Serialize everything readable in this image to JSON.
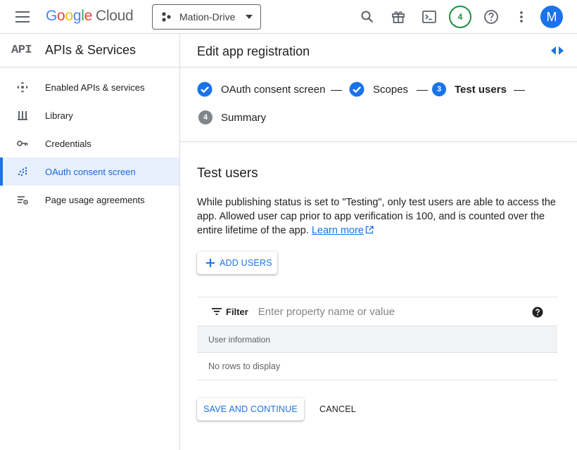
{
  "topbar": {
    "menu_icon": "hamburger-menu-icon",
    "logo": {
      "letters": [
        "G",
        "o",
        "o",
        "g",
        "l",
        "e"
      ],
      "product": "Cloud"
    },
    "project": {
      "name": "Mation-Drive",
      "icon": "project-icon",
      "dropdown_icon": "caret-down-icon"
    },
    "icons": [
      "search-icon",
      "gift-icon",
      "cloud-shell-icon",
      "notifications-badge",
      "help-icon",
      "more-vert-icon"
    ],
    "notification_count": "4",
    "avatar_initial": "M"
  },
  "sidebar": {
    "logo": "API",
    "title": "APIs & Services",
    "items": [
      {
        "label": "Enabled APIs & services",
        "icon": "move-icon",
        "active": false
      },
      {
        "label": "Library",
        "icon": "library-icon",
        "active": false
      },
      {
        "label": "Credentials",
        "icon": "key-icon",
        "active": false
      },
      {
        "label": "OAuth consent screen",
        "icon": "dotted-grid-icon",
        "active": true
      },
      {
        "label": "Page usage agreements",
        "icon": "settings-list-icon",
        "active": false
      }
    ]
  },
  "main": {
    "title": "Edit app registration",
    "steps": [
      {
        "label": "OAuth consent screen",
        "status": "done"
      },
      {
        "label": "Scopes",
        "status": "done"
      },
      {
        "label": "Test users",
        "number": "3",
        "status": "current"
      },
      {
        "label": "Summary",
        "number": "4",
        "status": "upcoming"
      }
    ],
    "section_title": "Test users",
    "description": "While publishing status is set to \"Testing\", only test users are able to access the app. Allowed user cap prior to app verification is 100, and is counted over the entire lifetime of the app.",
    "learn_more": "Learn more",
    "add_users_label": "ADD USERS",
    "filter": {
      "label": "Filter",
      "placeholder": "Enter property name or value"
    },
    "table": {
      "column": "User information",
      "empty_text": "No rows to display"
    },
    "save_label": "SAVE AND CONTINUE",
    "cancel_label": "CANCEL"
  },
  "colors": {
    "accent": "#1a73e8",
    "active_bg": "#e8f0fe",
    "success": "#1e8e3e",
    "muted": "#5f6368"
  }
}
